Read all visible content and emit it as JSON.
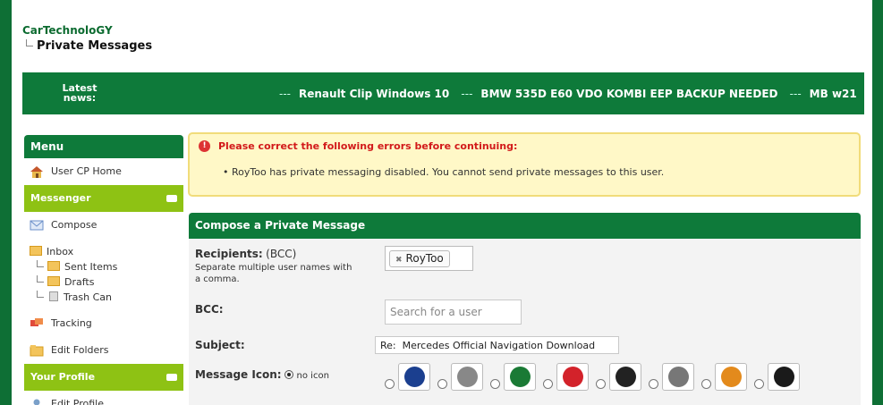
{
  "header": {
    "site_title": "CarTechnoloGY",
    "breadcrumb_current": "Private Messages"
  },
  "news": {
    "label": "Latest news:",
    "separator": "---",
    "items": [
      "Renault Clip Windows 10",
      "BMW 535D E60 VDO KOMBI EEP BACKUP NEEDED",
      "MB w21"
    ]
  },
  "sidebar": {
    "menu_title": "Menu",
    "user_cp_home": "User CP Home",
    "messenger_title": "Messenger",
    "compose": "Compose",
    "inbox": "Inbox",
    "sent_items": "Sent Items",
    "drafts": "Drafts",
    "trash_can": "Trash Can",
    "tracking": "Tracking",
    "edit_folders": "Edit Folders",
    "your_profile": "Your Profile",
    "edit_profile": "Edit Profile"
  },
  "error": {
    "heading": "Please correct the following errors before continuing:",
    "message": "RoyToo has private messaging disabled. You cannot send private messages to this user."
  },
  "compose": {
    "title": "Compose a Private Message",
    "recipients_label": "Recipients:",
    "recipients_suffix": "(BCC)",
    "recipients_hint": "Separate multiple user names with a comma.",
    "recipient_token": "RoyToo",
    "bcc_label": "BCC:",
    "bcc_placeholder": "Search for a user",
    "subject_label": "Subject:",
    "subject_value": "Re:  Mercedes Official Navigation Download",
    "message_icon_label": "Message Icon:",
    "no_icon_label": "no icon"
  },
  "icon_options": [
    {
      "name": "volkswagen-icon",
      "color": "#1b3f8f"
    },
    {
      "name": "audi-icon",
      "color": "#888888"
    },
    {
      "name": "skoda-icon",
      "color": "#1a7a35"
    },
    {
      "name": "seat-icon",
      "color": "#d3222a"
    },
    {
      "name": "bentley-icon",
      "color": "#222222"
    },
    {
      "name": "mercedes-icon",
      "color": "#777777"
    },
    {
      "name": "smart-icon",
      "color": "#e38a1c"
    },
    {
      "name": "bmw-icon",
      "color": "#1a1a1a"
    }
  ],
  "colors": {
    "brand_green": "#0e7a3a",
    "accent_lime": "#8ec214",
    "error_red": "#d21a1a",
    "error_bg": "#fff8c7"
  }
}
